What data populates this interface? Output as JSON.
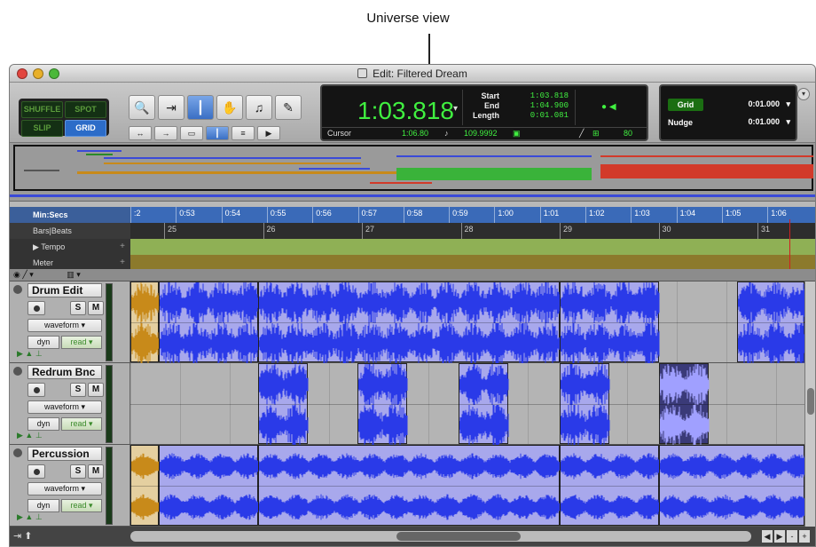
{
  "callout": {
    "label": "Universe view"
  },
  "window": {
    "title": "Edit: Filtered Dream"
  },
  "edit_modes": {
    "shuffle": "SHUFFLE",
    "spot": "SPOT",
    "slip": "SLIP",
    "grid": "GRID"
  },
  "counter": {
    "main": "1:03.818",
    "start_label": "Start",
    "end_label": "End",
    "length_label": "Length",
    "start": "1:03.818",
    "end": "1:04.900",
    "length": "0:01.081",
    "cursor_label": "Cursor",
    "cursor": "1:06.80",
    "tempo": "109.9992",
    "nudge_value": "80"
  },
  "grid_nudge": {
    "grid_label": "Grid",
    "grid_value": "0:01.000",
    "nudge_label": "Nudge",
    "nudge_value": "0:01.000"
  },
  "rulers": {
    "minsecs_label": "Min:Secs",
    "bars_label": "Bars|Beats",
    "tempo_label": "Tempo",
    "meter_label": "Meter",
    "minsecs_ticks": [
      ":2",
      "0:53",
      "0:54",
      "0:55",
      "0:56",
      "0:57",
      "0:58",
      "0:59",
      "1:00",
      "1:01",
      "1:02",
      "1:03",
      "1:04",
      "1:05",
      "1:06"
    ],
    "bars_ticks": [
      "25",
      "26",
      "27",
      "28",
      "29",
      "30",
      "31"
    ]
  },
  "tracks": [
    {
      "name": "Drum Edit",
      "view": "waveform",
      "dyn": "dyn",
      "mode": "read",
      "solo": "S",
      "mute": "M"
    },
    {
      "name": "Redrum Bnc",
      "view": "waveform",
      "dyn": "dyn",
      "mode": "read",
      "solo": "S",
      "mute": "M"
    },
    {
      "name": "Percussion",
      "view": "waveform",
      "dyn": "dyn",
      "mode": "read",
      "solo": "S",
      "mute": "M"
    }
  ],
  "colors": {
    "clip": "#a8a8ec",
    "wave": "#2a3ae8",
    "selected_wave": "#c88a1a",
    "counter_text": "#40f040"
  }
}
